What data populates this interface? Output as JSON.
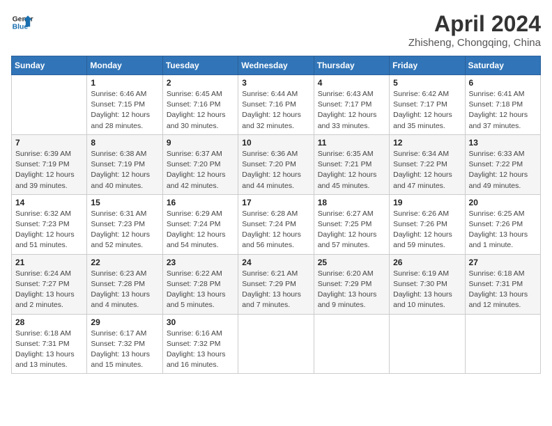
{
  "header": {
    "logo_line1": "General",
    "logo_line2": "Blue",
    "title": "April 2024",
    "subtitle": "Zhisheng, Chongqing, China"
  },
  "columns": [
    "Sunday",
    "Monday",
    "Tuesday",
    "Wednesday",
    "Thursday",
    "Friday",
    "Saturday"
  ],
  "weeks": [
    [
      {
        "day": "",
        "info": ""
      },
      {
        "day": "1",
        "info": "Sunrise: 6:46 AM\nSunset: 7:15 PM\nDaylight: 12 hours\nand 28 minutes."
      },
      {
        "day": "2",
        "info": "Sunrise: 6:45 AM\nSunset: 7:16 PM\nDaylight: 12 hours\nand 30 minutes."
      },
      {
        "day": "3",
        "info": "Sunrise: 6:44 AM\nSunset: 7:16 PM\nDaylight: 12 hours\nand 32 minutes."
      },
      {
        "day": "4",
        "info": "Sunrise: 6:43 AM\nSunset: 7:17 PM\nDaylight: 12 hours\nand 33 minutes."
      },
      {
        "day": "5",
        "info": "Sunrise: 6:42 AM\nSunset: 7:17 PM\nDaylight: 12 hours\nand 35 minutes."
      },
      {
        "day": "6",
        "info": "Sunrise: 6:41 AM\nSunset: 7:18 PM\nDaylight: 12 hours\nand 37 minutes."
      }
    ],
    [
      {
        "day": "7",
        "info": "Sunrise: 6:39 AM\nSunset: 7:19 PM\nDaylight: 12 hours\nand 39 minutes."
      },
      {
        "day": "8",
        "info": "Sunrise: 6:38 AM\nSunset: 7:19 PM\nDaylight: 12 hours\nand 40 minutes."
      },
      {
        "day": "9",
        "info": "Sunrise: 6:37 AM\nSunset: 7:20 PM\nDaylight: 12 hours\nand 42 minutes."
      },
      {
        "day": "10",
        "info": "Sunrise: 6:36 AM\nSunset: 7:20 PM\nDaylight: 12 hours\nand 44 minutes."
      },
      {
        "day": "11",
        "info": "Sunrise: 6:35 AM\nSunset: 7:21 PM\nDaylight: 12 hours\nand 45 minutes."
      },
      {
        "day": "12",
        "info": "Sunrise: 6:34 AM\nSunset: 7:22 PM\nDaylight: 12 hours\nand 47 minutes."
      },
      {
        "day": "13",
        "info": "Sunrise: 6:33 AM\nSunset: 7:22 PM\nDaylight: 12 hours\nand 49 minutes."
      }
    ],
    [
      {
        "day": "14",
        "info": "Sunrise: 6:32 AM\nSunset: 7:23 PM\nDaylight: 12 hours\nand 51 minutes."
      },
      {
        "day": "15",
        "info": "Sunrise: 6:31 AM\nSunset: 7:23 PM\nDaylight: 12 hours\nand 52 minutes."
      },
      {
        "day": "16",
        "info": "Sunrise: 6:29 AM\nSunset: 7:24 PM\nDaylight: 12 hours\nand 54 minutes."
      },
      {
        "day": "17",
        "info": "Sunrise: 6:28 AM\nSunset: 7:24 PM\nDaylight: 12 hours\nand 56 minutes."
      },
      {
        "day": "18",
        "info": "Sunrise: 6:27 AM\nSunset: 7:25 PM\nDaylight: 12 hours\nand 57 minutes."
      },
      {
        "day": "19",
        "info": "Sunrise: 6:26 AM\nSunset: 7:26 PM\nDaylight: 12 hours\nand 59 minutes."
      },
      {
        "day": "20",
        "info": "Sunrise: 6:25 AM\nSunset: 7:26 PM\nDaylight: 13 hours\nand 1 minute."
      }
    ],
    [
      {
        "day": "21",
        "info": "Sunrise: 6:24 AM\nSunset: 7:27 PM\nDaylight: 13 hours\nand 2 minutes."
      },
      {
        "day": "22",
        "info": "Sunrise: 6:23 AM\nSunset: 7:28 PM\nDaylight: 13 hours\nand 4 minutes."
      },
      {
        "day": "23",
        "info": "Sunrise: 6:22 AM\nSunset: 7:28 PM\nDaylight: 13 hours\nand 5 minutes."
      },
      {
        "day": "24",
        "info": "Sunrise: 6:21 AM\nSunset: 7:29 PM\nDaylight: 13 hours\nand 7 minutes."
      },
      {
        "day": "25",
        "info": "Sunrise: 6:20 AM\nSunset: 7:29 PM\nDaylight: 13 hours\nand 9 minutes."
      },
      {
        "day": "26",
        "info": "Sunrise: 6:19 AM\nSunset: 7:30 PM\nDaylight: 13 hours\nand 10 minutes."
      },
      {
        "day": "27",
        "info": "Sunrise: 6:18 AM\nSunset: 7:31 PM\nDaylight: 13 hours\nand 12 minutes."
      }
    ],
    [
      {
        "day": "28",
        "info": "Sunrise: 6:18 AM\nSunset: 7:31 PM\nDaylight: 13 hours\nand 13 minutes."
      },
      {
        "day": "29",
        "info": "Sunrise: 6:17 AM\nSunset: 7:32 PM\nDaylight: 13 hours\nand 15 minutes."
      },
      {
        "day": "30",
        "info": "Sunrise: 6:16 AM\nSunset: 7:32 PM\nDaylight: 13 hours\nand 16 minutes."
      },
      {
        "day": "",
        "info": ""
      },
      {
        "day": "",
        "info": ""
      },
      {
        "day": "",
        "info": ""
      },
      {
        "day": "",
        "info": ""
      }
    ]
  ]
}
